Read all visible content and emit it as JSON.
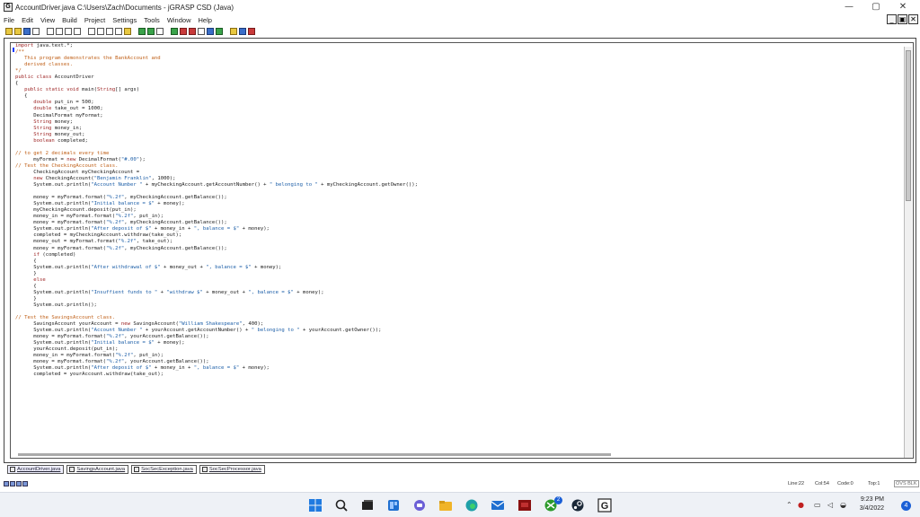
{
  "window": {
    "title": "AccountDriver.java  C:\\Users\\Zach\\Documents - jGRASP CSD (Java)",
    "minimize": "—",
    "maximize": "▢",
    "close": "✕"
  },
  "menu": {
    "items": [
      "File",
      "Edit",
      "View",
      "Build",
      "Project",
      "Settings",
      "Tools",
      "Window",
      "Help"
    ]
  },
  "mdi": {
    "minimize": "_",
    "restore": "▣",
    "close": "✕"
  },
  "code": {
    "lines": [
      "import java.text.*;",
      "/**",
      "   This program demonstrates the BankAccount and",
      "   derived classes.",
      "*/",
      "public class AccountDriver",
      "{",
      "   public static void main(String[] args)",
      "   {",
      "      double put_in = 500;",
      "      double take_out = 1000;",
      "      DecimalFormat myFormat;",
      "      String money;",
      "      String money_in;",
      "      String money_out;",
      "      boolean completed;",
      "",
      "// to get 2 decimals every time",
      "      myFormat = new DecimalFormat(\"#.00\");",
      "// Test the CheckingAccount class.",
      "      CheckingAccount myCheckingAccount =",
      "      new CheckingAccount(\"Benjamin Franklin\", 1000);",
      "      System.out.println(\"Account Number \" + myCheckingAccount.getAccountNumber() + \" belonging to \" + myCheckingAccount.getOwner());",
      "",
      "      money = myFormat.format(\"%.2f\", myCheckingAccount.getBalance());",
      "      System.out.println(\"Initial balance = $\" + money);",
      "      myCheckingAccount.deposit(put_in);",
      "      money_in = myFormat.format(\"%.2f\", put_in);",
      "      money = myFormat.format(\"%.2f\", myCheckingAccount.getBalance());",
      "      System.out.println(\"After deposit of $\" + money_in + \", balance = $\" + money);",
      "      completed = myCheckingAccount.withdraw(take_out);",
      "      money_out = myFormat.format(\"%.2f\", take_out);",
      "      money = myFormat.format(\"%.2f\", myCheckingAccount.getBalance());",
      "      if (completed)",
      "      {",
      "      System.out.println(\"After withdrawal of $\" + money_out + \", balance = $\" + money);",
      "      }",
      "      else",
      "      {",
      "      System.out.println(\"Insuffient funds to \" + \"withdraw $\" + money_out + \", balance = $\" + money);",
      "      }",
      "      System.out.println();",
      "",
      "// Test the SavingsAccount class.",
      "      SavingsAccount yourAccount = new SavingsAccount(\"William Shakespeare\", 400);",
      "      System.out.println(\"Account Number \" + yourAccount.getAccountNumber() + \" belonging to \" + yourAccount.getOwner());",
      "      money = myFormat.format(\"%.2f\", yourAccount.getBalance());",
      "      System.out.println(\"Initial balance = $\" + money);",
      "      yourAccount.deposit(put_in);",
      "      money_in = myFormat.format(\"%.2f\", put_in);",
      "      money = myFormat.format(\"%.2f\", yourAccount.getBalance());",
      "      System.out.println(\"After deposit of $\" + money_in + \", balance = $\" + money);",
      "      completed = yourAccount.withdraw(take_out);"
    ]
  },
  "tabs": [
    {
      "label": "AccountDriver.java",
      "active": true
    },
    {
      "label": "SavingsAccount.java",
      "active": false
    },
    {
      "label": "SocSecException.java",
      "active": false
    },
    {
      "label": "SocSecProcessor.java",
      "active": false
    }
  ],
  "status": {
    "line": "Line:22",
    "col": "Col:54",
    "code": "Code:0",
    "top": "Top:1",
    "mode": "OVS BLK"
  },
  "taskbar": {
    "icons": [
      "windows-start-icon",
      "search-icon",
      "task-view-icon",
      "widgets-icon",
      "teams-chat-icon",
      "file-explorer-icon",
      "edge-icon",
      "mail-icon",
      "app-red-icon",
      "xbox-icon",
      "steam-icon",
      "jgrasp-icon"
    ],
    "clock_time": "9:23 PM",
    "clock_date": "3/4/2022",
    "notification_count": "4",
    "badge_count": "2"
  },
  "colors": {
    "keyword": "#9b1f1f",
    "comment": "#c06018",
    "string": "#1d5fa8",
    "taskbar": "#eef1f6"
  }
}
